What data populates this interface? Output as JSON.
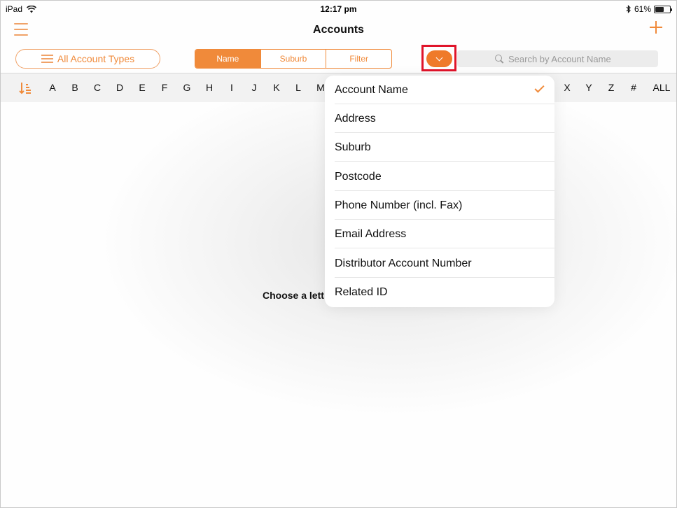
{
  "status_bar": {
    "device": "iPad",
    "time": "12:17 pm",
    "battery": "61%",
    "battery_level": 0.61
  },
  "nav": {
    "title": "Accounts"
  },
  "toolbar": {
    "account_types_label": "All Account Types",
    "segments": [
      {
        "label": "Name",
        "active": true
      },
      {
        "label": "Suburb",
        "active": false
      },
      {
        "label": "Filter",
        "active": false
      }
    ],
    "search_placeholder": "Search by Account Name"
  },
  "alphabet": {
    "visible_letters_left": [
      "A",
      "B",
      "C",
      "D",
      "E",
      "F",
      "G",
      "H",
      "I",
      "J",
      "K",
      "L",
      "M"
    ],
    "visible_letters_right": [
      "X",
      "Y",
      "Z",
      "#",
      "ALL"
    ]
  },
  "main": {
    "empty_hint": "Choose a lett"
  },
  "search_by_menu": {
    "items": [
      {
        "label": "Account Name",
        "selected": true
      },
      {
        "label": "Address",
        "selected": false
      },
      {
        "label": "Suburb",
        "selected": false
      },
      {
        "label": "Postcode",
        "selected": false
      },
      {
        "label": "Phone Number (incl. Fax)",
        "selected": false
      },
      {
        "label": "Email Address",
        "selected": false
      },
      {
        "label": "Distributor Account Number",
        "selected": false
      },
      {
        "label": "Related ID",
        "selected": false
      }
    ]
  },
  "colors": {
    "accent": "#f08a3a",
    "highlight": "#e0142a"
  }
}
